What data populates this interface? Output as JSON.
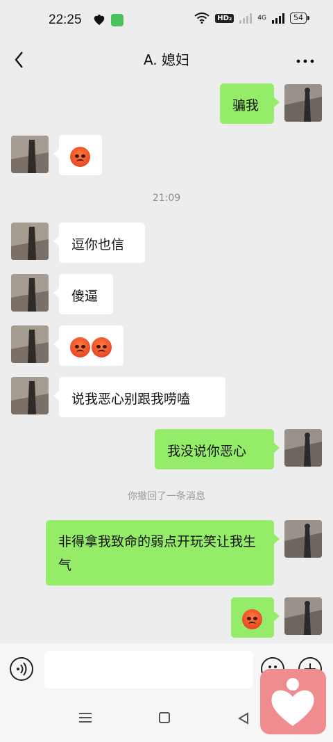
{
  "status_bar": {
    "time": "22:25",
    "network_badge": "HD₂",
    "network_type": "4G",
    "battery": "54"
  },
  "nav": {
    "title": "A. 媳妇"
  },
  "messages": [
    {
      "side": "out",
      "text": "骗我"
    },
    {
      "side": "in",
      "emoji": "angry-face"
    },
    {
      "timestamp": "21:09"
    },
    {
      "side": "in",
      "text": "逗你也信"
    },
    {
      "side": "in",
      "text": "傻逼"
    },
    {
      "side": "in",
      "emoji": "angry-face x2"
    },
    {
      "side": "in",
      "text": "说我恶心别跟我唠嗑"
    },
    {
      "side": "out",
      "text": "我没说你恶心"
    },
    {
      "system": "你撤回了一条消息"
    },
    {
      "side": "out",
      "text": "非得拿我致命的弱点开玩笑让我生气"
    },
    {
      "side": "out",
      "emoji": "angry-face"
    }
  ],
  "input": {
    "placeholder": ""
  },
  "colors": {
    "background": "#ededed",
    "outgoing_bubble": "#95ec69",
    "incoming_bubble": "#ffffff",
    "widget": "#ef8c8f"
  }
}
